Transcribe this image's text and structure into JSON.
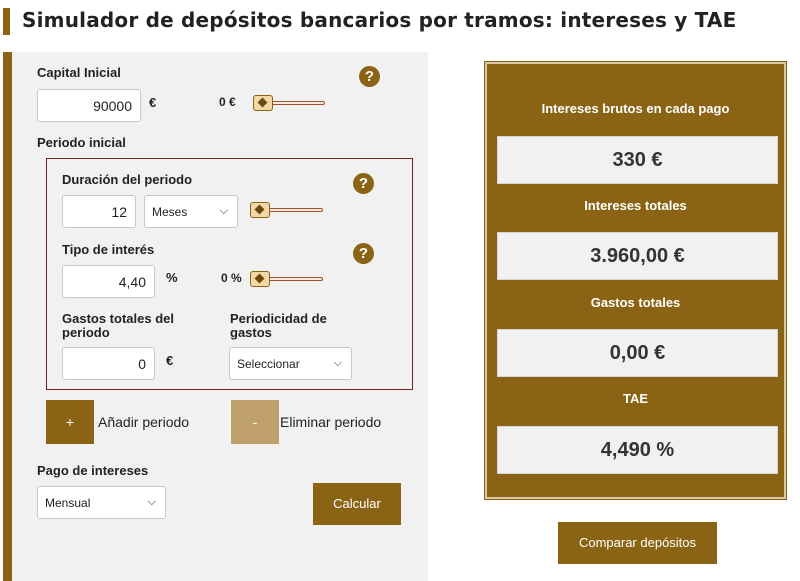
{
  "page": {
    "title": "Simulador de depósitos bancarios por tramos: intereses y TAE"
  },
  "form": {
    "capital": {
      "label": "Capital Inicial",
      "value": "90000",
      "unit": "€",
      "slider_min": "0 €",
      "slider_level": 0,
      "help": "?"
    },
    "period_heading": "Periodo inicial",
    "period": {
      "duration": {
        "label": "Duración del periodo",
        "value": "12",
        "unit_select": "Meses",
        "slider_level": 0,
        "help": "?"
      },
      "interest": {
        "label": "Tipo de interés",
        "value": "4,40",
        "unit": "%",
        "slider_min": "0 %",
        "slider_level": 0,
        "help": "?"
      },
      "expenses": {
        "label_line1": "Gastos totales del",
        "label_line2": "periodo",
        "value": "0",
        "unit": "€"
      },
      "expense_periodicity": {
        "label_line1": "Periodicidad de",
        "label_line2": "gastos",
        "selected": "Seleccionar"
      }
    },
    "add_period": {
      "symbol": "+",
      "label": "Añadir periodo"
    },
    "remove_period": {
      "symbol": "-",
      "label": "Eliminar periodo"
    },
    "interest_payment": {
      "label": "Pago de intereses",
      "selected": "Mensual"
    },
    "calculate_label": "Calcular"
  },
  "results": {
    "gross_interest_label": "Intereses brutos en cada pago",
    "gross_interest_value": "330 €",
    "total_interest_label": "Intereses totales",
    "total_interest_value": "3.960,00 €",
    "total_expenses_label": "Gastos totales",
    "total_expenses_value": "0,00 €",
    "tae_label": "TAE",
    "tae_value": "4,490 %"
  },
  "compare_label": "Comparar depósitos",
  "colors": {
    "accent": "#8a6414",
    "accent_light": "#bfa06a",
    "panel_bg": "#f1f1f1",
    "period_border": "#7a1f1f"
  },
  "icons": {
    "help": "help-icon",
    "chevron": "chevron-down-icon",
    "slider_handle": "slider-handle-icon"
  }
}
